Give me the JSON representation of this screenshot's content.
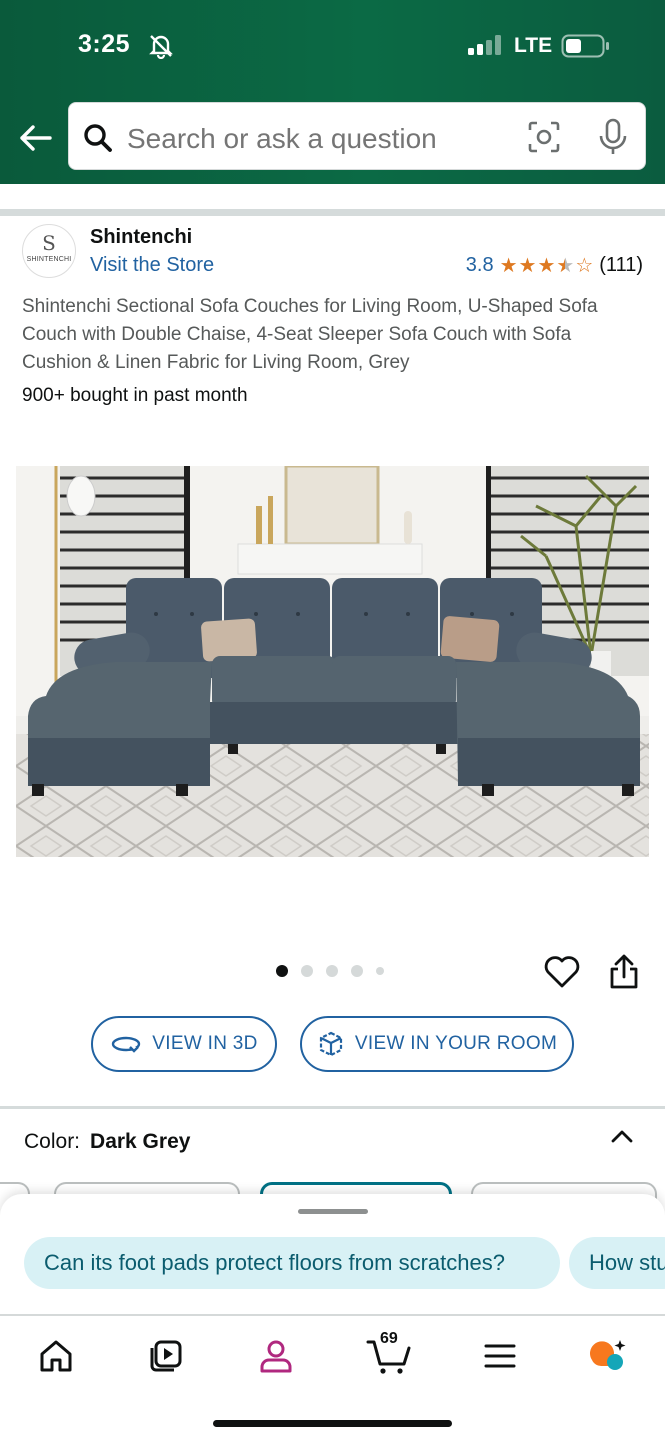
{
  "status_bar": {
    "time": "3:25",
    "network": "LTE"
  },
  "search": {
    "placeholder": "Search or ask a question"
  },
  "brand": {
    "logo_letter": "S",
    "logo_text": "SHINTENCHI",
    "name": "Shintenchi",
    "store_link": "Visit the Store"
  },
  "rating": {
    "value": "3.8",
    "stars": 3.8,
    "count": "(111)"
  },
  "product": {
    "title": "Shintenchi Sectional Sofa Couches for Living Room, U-Shaped Sofa Couch with Double Chaise, 4-Seat Sleeper Sofa Couch with Sofa Cushion & Linen Fabric for Living Room, Grey",
    "bought": "900+ bought in past month",
    "image_count": 5,
    "current_image": 1
  },
  "actions": {
    "view_3d": "VIEW IN 3D",
    "view_room": "VIEW IN YOUR ROOM"
  },
  "color": {
    "label": "Color:",
    "value": "Dark Grey"
  },
  "questions": [
    "Can its foot pads protect floors from scratches?",
    "How stu"
  ],
  "nav": {
    "items": [
      "home-icon",
      "video-icon",
      "account-icon",
      "cart-icon",
      "menu-icon",
      "rufus-icon"
    ],
    "cart_count": "69"
  },
  "colors": {
    "header": "#0b6a45",
    "link": "#2162a1",
    "star": "#de7921",
    "chip": "#d8f1f5"
  }
}
